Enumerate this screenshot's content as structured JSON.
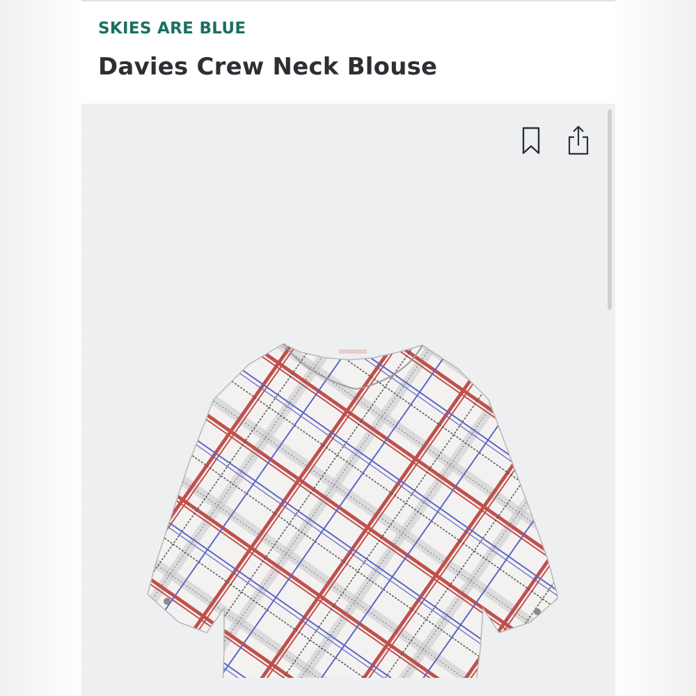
{
  "product": {
    "brand": "SKIES ARE BLUE",
    "title": "Davies Crew Neck Blouse"
  },
  "actions": {
    "bookmark_icon": "bookmark-icon",
    "share_icon": "share-icon"
  },
  "image": {
    "subject": "product-photo-plaid-blouse"
  },
  "colors": {
    "brand": "#1b6f62",
    "title": "#2c2f33",
    "image_background": "#eeeff1",
    "plaid_red": "#c0504d",
    "plaid_blue": "#5a64c8",
    "plaid_dark": "#4a4a50",
    "fabric": "#f4f2f0"
  }
}
